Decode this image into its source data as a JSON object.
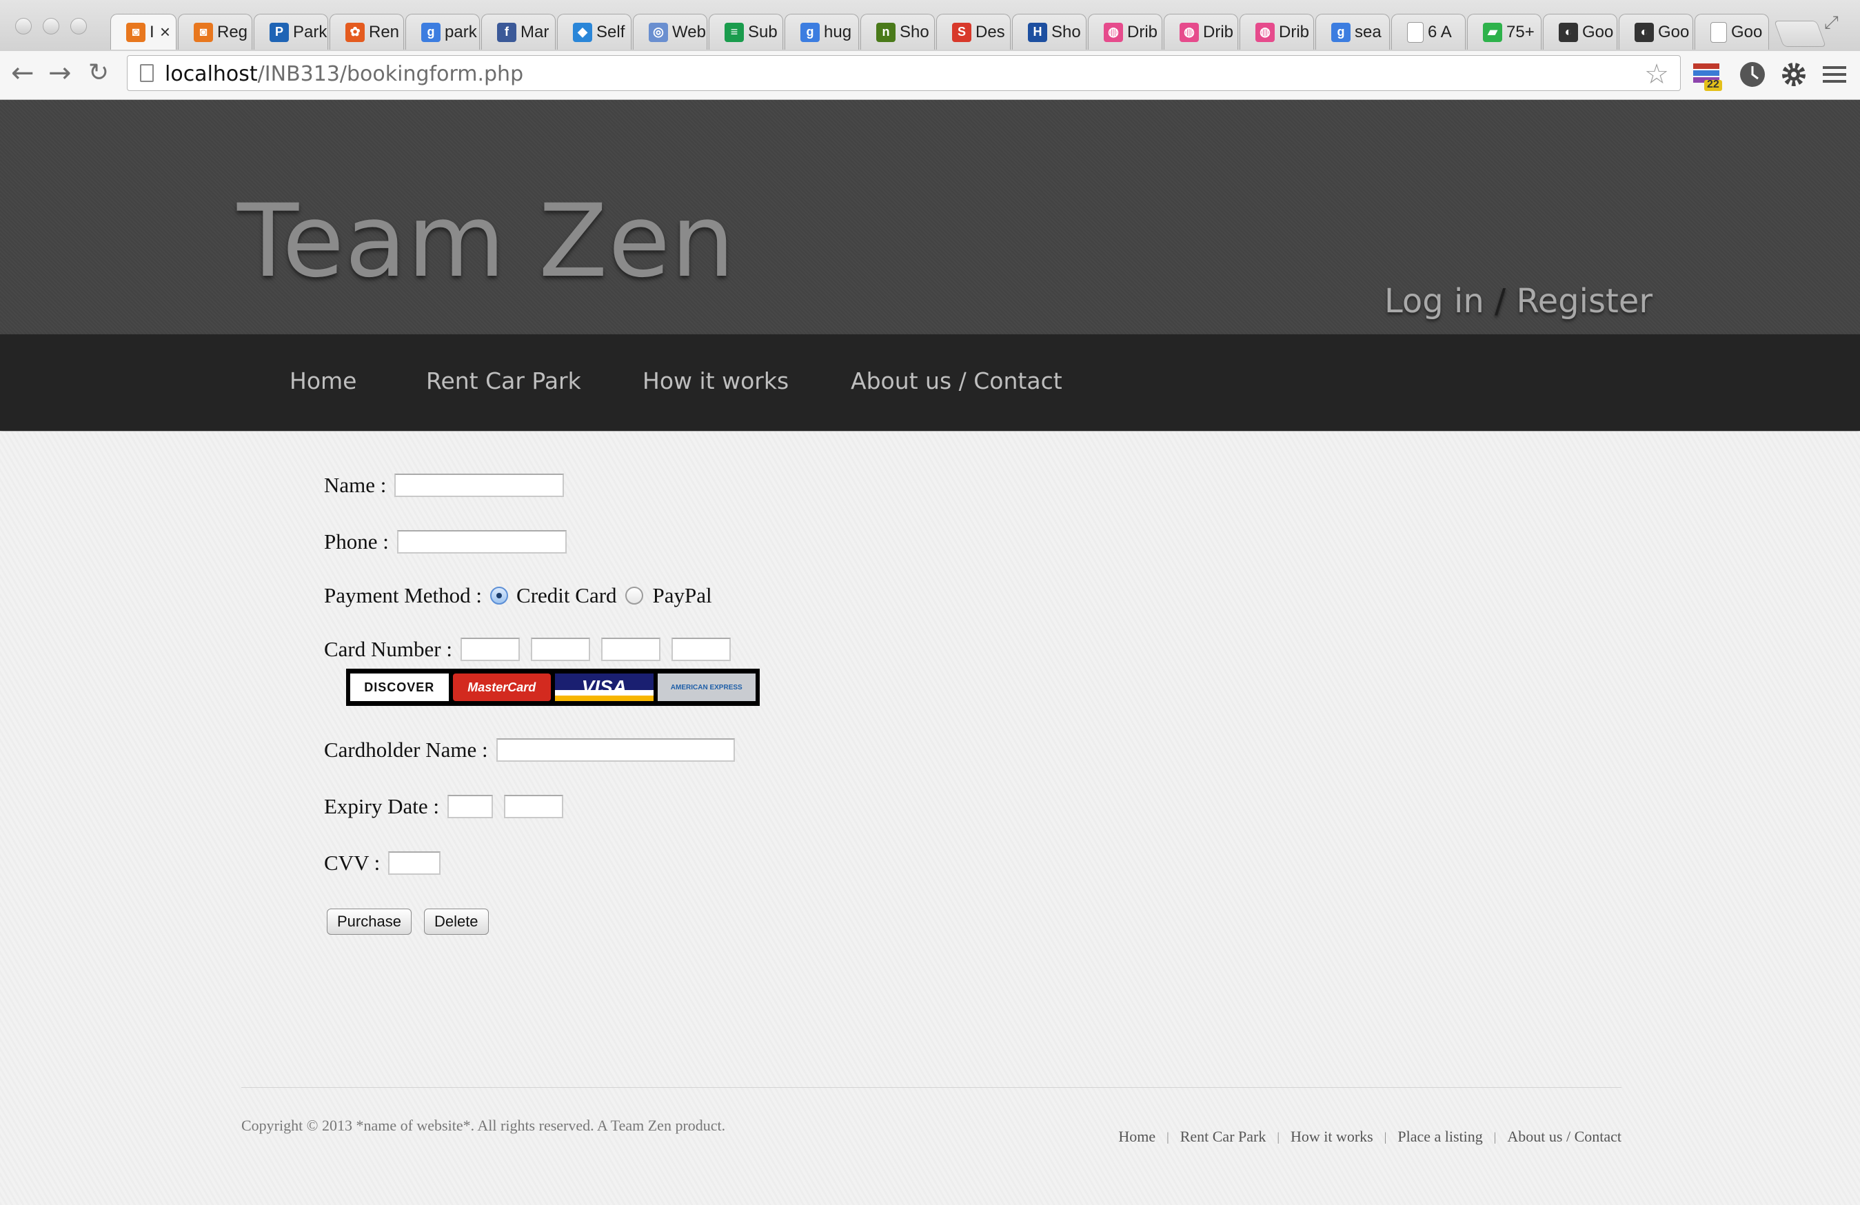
{
  "browser": {
    "tabs": [
      {
        "label": "I",
        "color": "#e8771e",
        "glyph": "◙",
        "active": true
      },
      {
        "label": "Reg",
        "color": "#e8771e",
        "glyph": "◙"
      },
      {
        "label": "Park",
        "color": "#1f64b5",
        "glyph": "P"
      },
      {
        "label": "Ren",
        "color": "#e45b1f",
        "glyph": "✿"
      },
      {
        "label": "park",
        "color": "#3c7de0",
        "glyph": "g"
      },
      {
        "label": "Mar",
        "color": "#3b5998",
        "glyph": "f"
      },
      {
        "label": "Self",
        "color": "#2a86d8",
        "glyph": "◆"
      },
      {
        "label": "Web",
        "color": "#6a8fd0",
        "glyph": "◎"
      },
      {
        "label": "Sub",
        "color": "#1a9c4d",
        "glyph": "≡"
      },
      {
        "label": "hug",
        "color": "#3c7de0",
        "glyph": "g"
      },
      {
        "label": "Sho",
        "color": "#4a7a1a",
        "glyph": "n"
      },
      {
        "label": "Des",
        "color": "#d8392b",
        "glyph": "S"
      },
      {
        "label": "Sho",
        "color": "#1d4fa0",
        "glyph": "H"
      },
      {
        "label": "Drib",
        "color": "#e64b8c",
        "glyph": "◍"
      },
      {
        "label": "Drib",
        "color": "#e64b8c",
        "glyph": "◍"
      },
      {
        "label": "Drib",
        "color": "#e64b8c",
        "glyph": "◍"
      },
      {
        "label": "sea",
        "color": "#3c7de0",
        "glyph": "g"
      },
      {
        "label": "6 A",
        "color": "#ffffff",
        "glyph": ""
      },
      {
        "label": "75+",
        "color": "#2eb24b",
        "glyph": "▰"
      },
      {
        "label": "Goo",
        "color": "#333333",
        "glyph": "◐"
      },
      {
        "label": "Goo",
        "color": "#333333",
        "glyph": "◐"
      },
      {
        "label": "Goo",
        "color": "#ffffff",
        "glyph": ""
      }
    ],
    "url_host": "localhost",
    "url_path": "/INB313/bookingform.php",
    "extension_badge": "22"
  },
  "site": {
    "brand": "Team Zen",
    "login": "Log in",
    "auth_sep": "/",
    "register": "Register",
    "nav": [
      "Home",
      "Rent Car Park",
      "How it works",
      "About us / Contact"
    ]
  },
  "form": {
    "name_label": "Name :",
    "phone_label": "Phone :",
    "payment_label": "Payment Method :",
    "credit_card": "Credit Card",
    "paypal": "PayPal",
    "selected_payment": "Credit Card",
    "card_number_label": "Card Number :",
    "cards": [
      "DISCOVER",
      "MasterCard",
      "VISA",
      "AMERICAN EXPRESS"
    ],
    "cardholder_label": "Cardholder Name :",
    "expiry_label": "Expiry Date :",
    "cvv_label": "CVV :",
    "purchase": "Purchase",
    "delete": "Delete"
  },
  "footer": {
    "copyright": "Copyright © 2013 *name of website*. All rights reserved. A Team Zen product.",
    "links": [
      "Home",
      "Rent Car Park",
      "How it works",
      "Place a listing",
      "About us / Contact"
    ],
    "separator": "|"
  }
}
